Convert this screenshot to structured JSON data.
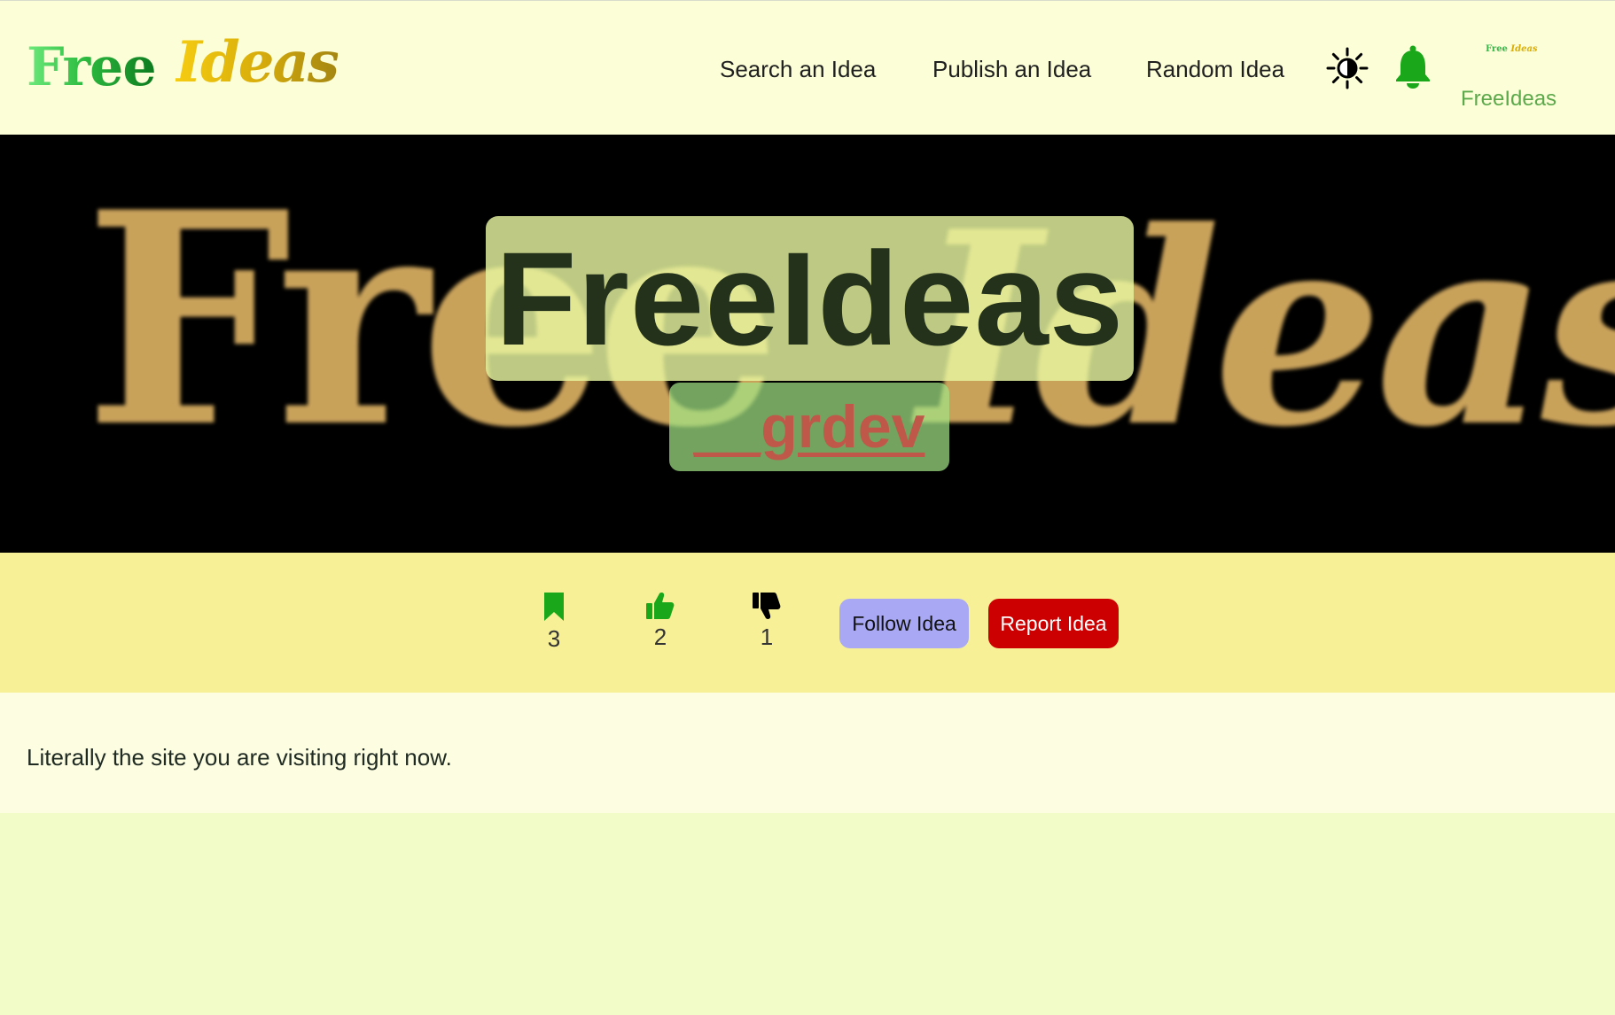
{
  "header": {
    "logo": {
      "free": "Free",
      "ideas": "Ideas"
    },
    "nav": {
      "search": "Search an Idea",
      "publish": "Publish an Idea",
      "random": "Random Idea"
    },
    "icons": {
      "theme": "sun-icon",
      "notifications": "bell-icon"
    },
    "profile": {
      "avatar_free": "Free",
      "avatar_ideas": "Ideas",
      "name": "FreeIdeas"
    }
  },
  "banner": {
    "background_art": {
      "free": "Free",
      "ideas": "Ideas"
    },
    "title": "FreeIdeas",
    "author": "__grdev"
  },
  "actions": {
    "bookmarks": {
      "icon": "bookmark-icon",
      "count": "3"
    },
    "likes": {
      "icon": "thumbs-up-icon",
      "count": "2"
    },
    "dislikes": {
      "icon": "thumbs-down-icon",
      "count": "1"
    },
    "follow_label": "Follow Idea",
    "report_label": "Report Idea"
  },
  "description": {
    "text": "Literally the site you are visiting right now."
  },
  "colors": {
    "header_bg": "#fbfed6",
    "page_bg": "#f2fcc8",
    "action_bar_bg": "#f7f097",
    "description_bg": "#fdfde2",
    "accent_green": "#1aa81a",
    "follow_button": "#a8a8f5",
    "report_button": "#cc0000",
    "banner_art_gold": "#c9a25a"
  }
}
